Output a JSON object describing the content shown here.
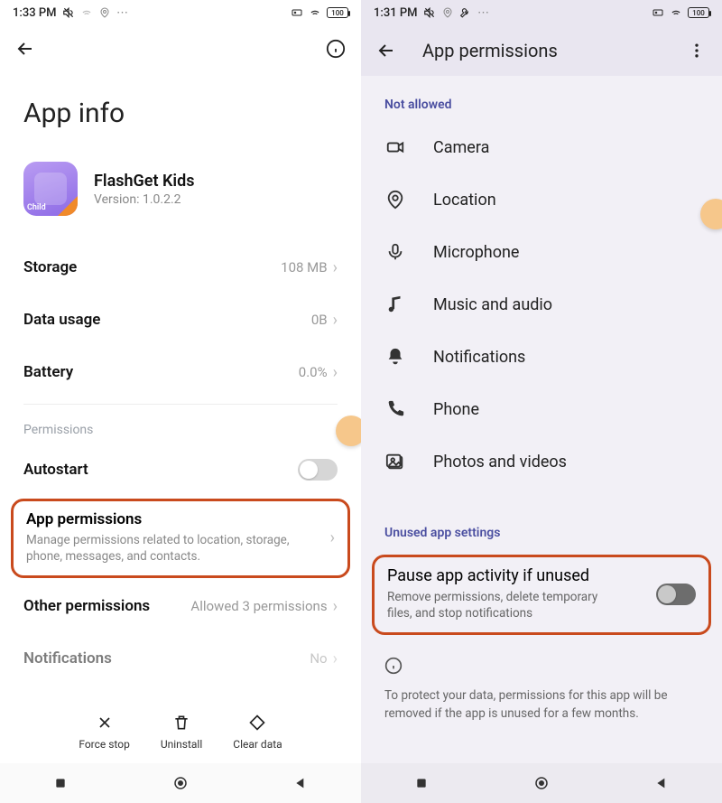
{
  "left": {
    "status_time": "1:33 PM",
    "battery_text": "100",
    "page_title": "App info",
    "app_name": "FlashGet Kids",
    "app_version": "Version: 1.0.2.2",
    "rows": {
      "storage_label": "Storage",
      "storage_value": "108 MB",
      "data_label": "Data usage",
      "data_value": "0B",
      "battery_label": "Battery",
      "battery_value": "0.0%"
    },
    "permissions_header": "Permissions",
    "autostart_label": "Autostart",
    "app_permissions_label": "App permissions",
    "app_permissions_sub": "Manage permissions related to location, storage, phone, messages, and contacts.",
    "other_permissions_label": "Other permissions",
    "other_permissions_value": "Allowed 3 permissions",
    "notifications_label": "Notifications",
    "notifications_value": "No",
    "actions": {
      "force_stop": "Force stop",
      "uninstall": "Uninstall",
      "clear_data": "Clear data"
    },
    "app_icon_badge": "Child"
  },
  "right": {
    "status_time": "1:31 PM",
    "battery_text": "100",
    "page_title": "App permissions",
    "section_not_allowed": "Not allowed",
    "perms": {
      "camera": "Camera",
      "location": "Location",
      "microphone": "Microphone",
      "music": "Music and audio",
      "notifications": "Notifications",
      "phone": "Phone",
      "photos": "Photos and videos"
    },
    "section_unused": "Unused app settings",
    "pause_label": "Pause app activity if unused",
    "pause_sub": "Remove permissions, delete temporary files, and stop notifications",
    "footnote": "To protect your data, permissions for this app will be removed if the app is unused for a few months."
  }
}
